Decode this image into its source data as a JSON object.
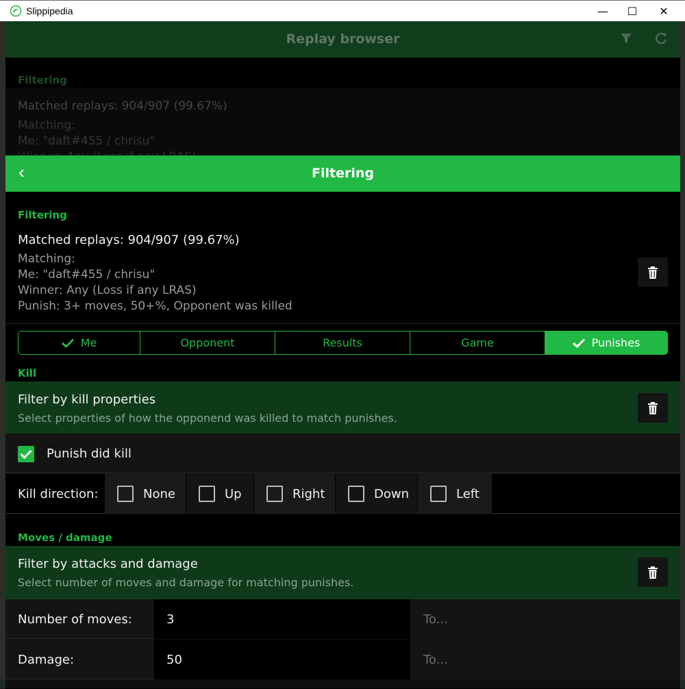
{
  "window": {
    "app_title": "Slippipedia",
    "minimize": "—",
    "maximize": "☐",
    "close": "✕"
  },
  "background_page": {
    "header_title": "Replay browser",
    "section_title": "Filtering",
    "matched": "Matched replays: 904/907 (99.67%)",
    "matching_label": "Matching:",
    "me": "Me: \"daft#455 / chrisu\"",
    "winner": "Winner: Any (Loss if any LRAS)"
  },
  "sheet": {
    "title": "Filtering",
    "summary": {
      "section_title": "Filtering",
      "matched": "Matched replays: 904/907 (99.67%)",
      "lines": [
        "Matching:",
        "Me: \"daft#455 / chrisu\"",
        "Winner: Any (Loss if any LRAS)",
        "Punish: 3+ moves, 50+%, Opponent was killed"
      ]
    },
    "tabs": [
      {
        "label": "Me",
        "checked": true
      },
      {
        "label": "Opponent",
        "checked": false
      },
      {
        "label": "Results",
        "checked": false
      },
      {
        "label": "Game",
        "checked": false
      },
      {
        "label": "Punishes",
        "checked": true
      }
    ],
    "kill": {
      "section_title": "Kill",
      "card_title": "Filter by kill properties",
      "card_subtitle": "Select properties of how the opponend was killed to match punishes.",
      "punish_did_kill_label": "Punish did kill",
      "punish_did_kill_checked": true,
      "direction_label": "Kill direction:",
      "directions": [
        "None",
        "Up",
        "Right",
        "Down",
        "Left"
      ]
    },
    "moves": {
      "section_title": "Moves / damage",
      "card_title": "Filter by attacks and damage",
      "card_subtitle": "Select number of moves and damage for matching punishes.",
      "moves_label": "Number of moves:",
      "moves_from": "3",
      "moves_to_placeholder": "To...",
      "damage_label": "Damage:",
      "damage_from": "50",
      "damage_to_placeholder": "To..."
    }
  },
  "colors": {
    "accent": "#22b845",
    "card_green": "#0f3a1a",
    "dim_header": "#113d1d"
  }
}
